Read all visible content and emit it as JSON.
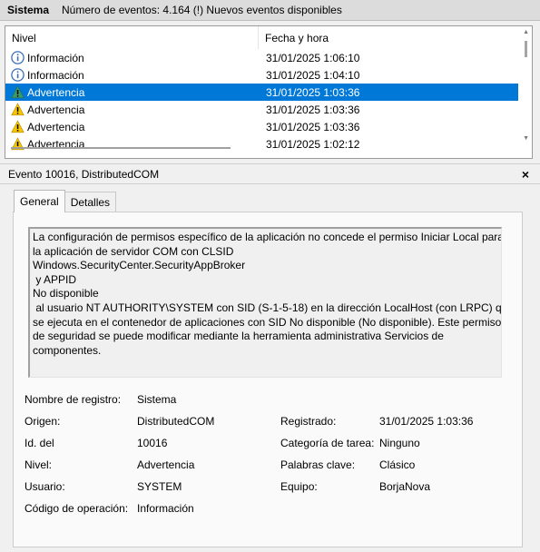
{
  "header": {
    "title": "Sistema",
    "count_text": "Número de eventos: 4.164 (!) Nuevos eventos disponibles"
  },
  "list": {
    "columns": {
      "level": "Nivel",
      "date": "Fecha y hora"
    },
    "rows": [
      {
        "level": "Información",
        "date": "31/01/2025 1:06:10",
        "icon": "info-icon"
      },
      {
        "level": "Información",
        "date": "31/01/2025 1:04:10",
        "icon": "info-icon"
      },
      {
        "level": "Advertencia",
        "date": "31/01/2025 1:03:36",
        "icon": "warning-icon",
        "selected": true
      },
      {
        "level": "Advertencia",
        "date": "31/01/2025 1:03:36",
        "icon": "warning-icon"
      },
      {
        "level": "Advertencia",
        "date": "31/01/2025 1:03:36",
        "icon": "warning-icon"
      },
      {
        "level": "Advertencia",
        "date": "31/01/2025 1:02:12",
        "icon": "warning-icon"
      }
    ]
  },
  "detail": {
    "title": "Evento 10016, DistributedCOM",
    "close": "×",
    "tabs": {
      "general": "General",
      "details": "Detalles"
    },
    "message": [
      "La configuración de permisos específico de la aplicación no concede el permiso Iniciar Local para",
      "la aplicación de servidor COM con CLSID",
      "Windows.SecurityCenter.SecurityAppBroker",
      " y APPID",
      "No disponible",
      " al usuario NT AUTHORITY\\SYSTEM con SID (S-1-5-18) en la dirección LocalHost (con LRPC) que",
      "se ejecuta en el contenedor de aplicaciones con SID No disponible (No disponible). Este permiso",
      "de seguridad se puede modificar mediante la herramienta administrativa Servicios de",
      "componentes."
    ],
    "fields": {
      "log_name_label": "Nombre de registro:",
      "log_name": "Sistema",
      "source_label": "Origen:",
      "source": "DistributedCOM",
      "logged_label": "Registrado:",
      "logged": "31/01/2025 1:03:36",
      "event_id_label": "Id. del",
      "event_id": "10016",
      "task_label": "Categoría de tarea:",
      "task": "Ninguno",
      "level_label": "Nivel:",
      "level": "Advertencia",
      "keywords_label": "Palabras clave:",
      "keywords": "Clásico",
      "user_label": "Usuario:",
      "user": "SYSTEM",
      "computer_label": "Equipo:",
      "computer": "BorjaNova",
      "opcode_label": "Código de operación:",
      "opcode": "Información"
    }
  },
  "colors": {
    "selection": "#0078d7",
    "info": "#1f5fb0",
    "warning": "#f7c600"
  }
}
